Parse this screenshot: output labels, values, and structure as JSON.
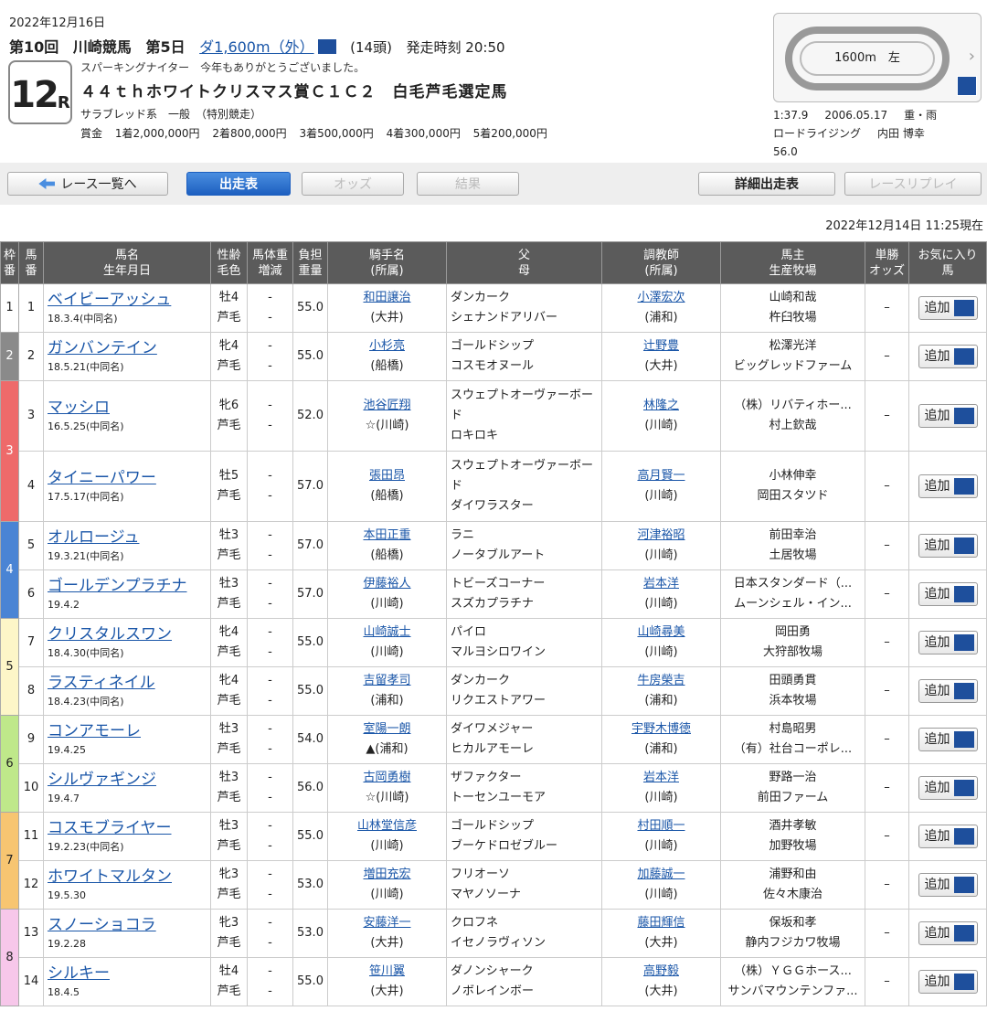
{
  "header": {
    "date": "2022年12月16日",
    "kai": "第10回",
    "venue": "川崎競馬",
    "day": "第5日",
    "distance": "ダ1,600m（外）",
    "runners": "(14頭)",
    "post_time": "発走時刻 20:50",
    "race_no": "12",
    "race_r": "R",
    "subtitle": "スパーキングナイター　今年もありがとうございました。",
    "title": "４４ｔｈホワイトクリスマス賞Ｃ１Ｃ２　白毛芦毛選定馬",
    "conditions": "サラブレッド系　一般　（特別競走）",
    "prizes": [
      "賞金",
      "1着2,000,000円",
      "2着800,000円",
      "3着500,000円",
      "4着300,000円",
      "5着200,000円"
    ]
  },
  "course": {
    "label": "1600m　左",
    "chevron": "›"
  },
  "record": {
    "time": "1:37.9",
    "date": "2006.05.17",
    "going": "重・雨",
    "horse": "ロードライジング",
    "jockey": "内田 博幸",
    "weight": "56.0"
  },
  "buttons": {
    "back": "レース一覧へ",
    "entries": "出走表",
    "odds": "オッズ",
    "results": "結果",
    "detail": "詳細出走表",
    "replay": "レースリプレイ"
  },
  "as_of": "2022年12月14日 11:25現在",
  "columns": {
    "waku": "枠\n番",
    "uma": "馬\n番",
    "name": "馬名\n生年月日",
    "sex": "性齢\n毛色",
    "weight": "馬体重\n増減",
    "burden": "負担\n重量",
    "jockey": "騎手名\n(所属)",
    "sire": "父\n母",
    "trainer": "調教師\n(所属)",
    "owner": "馬主\n生産牧場",
    "odds": "単勝\nオッズ",
    "fav": "お気に入り\n馬"
  },
  "fav_label": "追加",
  "colors": {
    "waku1": "#ffffff",
    "waku2": "#8a8a8a",
    "waku3": "#ee6a6a",
    "waku4": "#4a84d4",
    "waku5": "#fdf6c8",
    "waku6": "#bfe88a",
    "waku7": "#f7c571",
    "waku8": "#f7c7ea"
  },
  "horses": [
    {
      "waku": "1",
      "no": "1",
      "name": "ベイビーアッシュ",
      "birth": "18.3.4(中同名)",
      "sex": "牡4",
      "coat": "芦毛",
      "w": "-",
      "wd": "-",
      "burden": "55.0",
      "mark": "",
      "jockey": "和田譲治",
      "jaff": "(大井)",
      "sire": "ダンカーク",
      "dam": "シェナンドアリバー",
      "trainer": "小澤宏次",
      "taff": "(浦和)",
      "owner": "山崎和哉",
      "breeder": "杵臼牧場",
      "odds": "–"
    },
    {
      "waku": "2",
      "no": "2",
      "name": "ガンバンテイン",
      "birth": "18.5.21(中同名)",
      "sex": "牝4",
      "coat": "芦毛",
      "w": "-",
      "wd": "-",
      "burden": "55.0",
      "mark": "",
      "jockey": "小杉亮",
      "jaff": "(船橋)",
      "sire": "ゴールドシップ",
      "dam": "コスモオヌール",
      "trainer": "辻野豊",
      "taff": "(大井)",
      "owner": "松澤光洋",
      "breeder": "ビッグレッドファーム",
      "odds": "–"
    },
    {
      "waku": "3",
      "no": "3",
      "name": "マッシロ",
      "birth": "16.5.25(中同名)",
      "sex": "牝6",
      "coat": "芦毛",
      "w": "-",
      "wd": "-",
      "burden": "52.0",
      "mark": "☆",
      "jockey": "池谷匠翔",
      "jaff": "(川崎)",
      "sire": "スウェプトオーヴァーボード",
      "dam": "ロキロキ",
      "trainer": "林隆之",
      "taff": "(川崎)",
      "owner": "（株）リバティホー...",
      "breeder": "村上欽哉",
      "odds": "–"
    },
    {
      "waku": "3",
      "no": "4",
      "name": "タイニーパワー",
      "birth": "17.5.17(中同名)",
      "sex": "牡5",
      "coat": "芦毛",
      "w": "-",
      "wd": "-",
      "burden": "57.0",
      "mark": "",
      "jockey": "張田昂",
      "jaff": "(船橋)",
      "sire": "スウェプトオーヴァーボード",
      "dam": "ダイワラスター",
      "trainer": "高月賢一",
      "taff": "(川崎)",
      "owner": "小林伸幸",
      "breeder": "岡田スタツド",
      "odds": "–"
    },
    {
      "waku": "4",
      "no": "5",
      "name": "オルロージュ",
      "birth": "19.3.21(中同名)",
      "sex": "牡3",
      "coat": "芦毛",
      "w": "-",
      "wd": "-",
      "burden": "57.0",
      "mark": "",
      "jockey": "本田正重",
      "jaff": "(船橋)",
      "sire": "ラニ",
      "dam": "ノータブルアート",
      "trainer": "河津裕昭",
      "taff": "(川崎)",
      "owner": "前田幸治",
      "breeder": "土居牧場",
      "odds": "–"
    },
    {
      "waku": "4",
      "no": "6",
      "name": "ゴールデンプラチナ",
      "birth": "19.4.2",
      "sex": "牡3",
      "coat": "芦毛",
      "w": "-",
      "wd": "-",
      "burden": "57.0",
      "mark": "",
      "jockey": "伊藤裕人",
      "jaff": "(川崎)",
      "sire": "トビーズコーナー",
      "dam": "スズカプラチナ",
      "trainer": "岩本洋",
      "taff": "(川崎)",
      "owner": "日本スタンダード（...",
      "breeder": "ムーンシェル・イン...",
      "odds": "–"
    },
    {
      "waku": "5",
      "no": "7",
      "name": "クリスタルスワン",
      "birth": "18.4.30(中同名)",
      "sex": "牝4",
      "coat": "芦毛",
      "w": "-",
      "wd": "-",
      "burden": "55.0",
      "mark": "",
      "jockey": "山崎誠士",
      "jaff": "(川崎)",
      "sire": "パイロ",
      "dam": "マルヨシロワイン",
      "trainer": "山崎尋美",
      "taff": "(川崎)",
      "owner": "岡田勇",
      "breeder": "大狩部牧場",
      "odds": "–"
    },
    {
      "waku": "5",
      "no": "8",
      "name": "ラスティネイル",
      "birth": "18.4.23(中同名)",
      "sex": "牝4",
      "coat": "芦毛",
      "w": "-",
      "wd": "-",
      "burden": "55.0",
      "mark": "",
      "jockey": "吉留孝司",
      "jaff": "(浦和)",
      "sire": "ダンカーク",
      "dam": "リクエストアワー",
      "trainer": "牛房榮吉",
      "taff": "(浦和)",
      "owner": "田頭勇貫",
      "breeder": "浜本牧場",
      "odds": "–"
    },
    {
      "waku": "6",
      "no": "9",
      "name": "コンアモーレ",
      "birth": "19.4.25",
      "sex": "牡3",
      "coat": "芦毛",
      "w": "-",
      "wd": "-",
      "burden": "54.0",
      "mark": "▲",
      "jockey": "室陽一朗",
      "jaff": "(浦和)",
      "sire": "ダイワメジャー",
      "dam": "ヒカルアモーレ",
      "trainer": "宇野木博徳",
      "taff": "(浦和)",
      "owner": "村島昭男",
      "breeder": "（有）社台コーポレ...",
      "odds": "–"
    },
    {
      "waku": "6",
      "no": "10",
      "name": "シルヴァギンジ",
      "birth": "19.4.7",
      "sex": "牡3",
      "coat": "芦毛",
      "w": "-",
      "wd": "-",
      "burden": "56.0",
      "mark": "☆",
      "jockey": "古岡勇樹",
      "jaff": "(川崎)",
      "sire": "ザファクター",
      "dam": "トーセンユーモア",
      "trainer": "岩本洋",
      "taff": "(川崎)",
      "owner": "野路一治",
      "breeder": "前田ファーム",
      "odds": "–"
    },
    {
      "waku": "7",
      "no": "11",
      "name": "コスモブライヤー",
      "birth": "19.2.23(中同名)",
      "sex": "牡3",
      "coat": "芦毛",
      "w": "-",
      "wd": "-",
      "burden": "55.0",
      "mark": "",
      "jockey": "山林堂信彦",
      "jaff": "(川崎)",
      "sire": "ゴールドシップ",
      "dam": "ブーケドロゼブルー",
      "trainer": "村田順一",
      "taff": "(川崎)",
      "owner": "酒井孝敏",
      "breeder": "加野牧場",
      "odds": "–"
    },
    {
      "waku": "7",
      "no": "12",
      "name": "ホワイトマルタン",
      "birth": "19.5.30",
      "sex": "牝3",
      "coat": "芦毛",
      "w": "-",
      "wd": "-",
      "burden": "53.0",
      "mark": "",
      "jockey": "増田充宏",
      "jaff": "(川崎)",
      "sire": "フリオーソ",
      "dam": "マヤノソーナ",
      "trainer": "加藤誠一",
      "taff": "(川崎)",
      "owner": "浦野和由",
      "breeder": "佐々木康治",
      "odds": "–"
    },
    {
      "waku": "8",
      "no": "13",
      "name": "スノーショコラ",
      "birth": "19.2.28",
      "sex": "牝3",
      "coat": "芦毛",
      "w": "-",
      "wd": "-",
      "burden": "53.0",
      "mark": "",
      "jockey": "安藤洋一",
      "jaff": "(大井)",
      "sire": "クロフネ",
      "dam": "イセノラヴィソン",
      "trainer": "藤田輝信",
      "taff": "(大井)",
      "owner": "保坂和孝",
      "breeder": "静内フジカワ牧場",
      "odds": "–"
    },
    {
      "waku": "8",
      "no": "14",
      "name": "シルキー",
      "birth": "18.4.5",
      "sex": "牡4",
      "coat": "芦毛",
      "w": "-",
      "wd": "-",
      "burden": "55.0",
      "mark": "",
      "jockey": "笹川翼",
      "jaff": "(大井)",
      "sire": "ダノンシャーク",
      "dam": "ノボレインボー",
      "trainer": "高野毅",
      "taff": "(大井)",
      "owner": "（株）ＹＧＧホース...",
      "breeder": "サンバマウンテンファ...",
      "odds": "–"
    }
  ]
}
